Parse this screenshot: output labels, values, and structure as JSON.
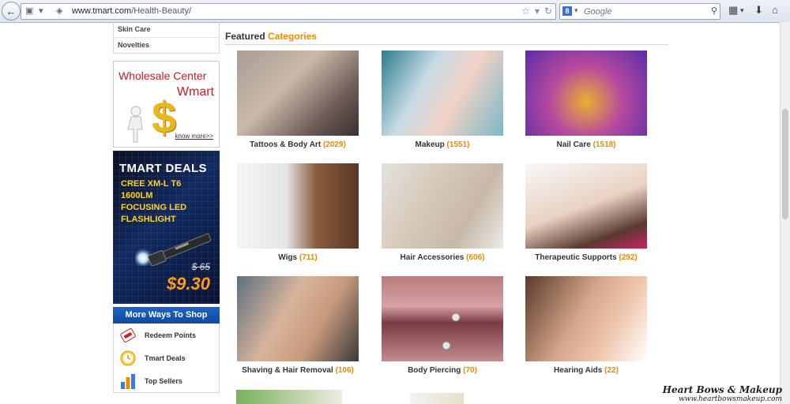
{
  "browser": {
    "url_host": "www.tmart.com",
    "url_path": "/Health-Beauty/",
    "search_placeholder": "Google",
    "search_engine_letter": "8"
  },
  "sidebar": {
    "categories": [
      "Skin Care",
      "Novelties"
    ],
    "wholesale_ad": {
      "title": "Wholesale Center",
      "subtitle": "Wmart",
      "link": "know more>>"
    },
    "deals_ad": {
      "title": "TMART DEALS",
      "lines": [
        "CREE XM-L T6",
        "1600LM",
        "FOCUSING LED",
        "FLASHLIGHT"
      ],
      "old_price": "$ 65",
      "new_price": "$9.30"
    },
    "more_ways": {
      "heading": "More Ways To Shop",
      "items": [
        "Redeem Points",
        "Tmart Deals",
        "Top Sellers"
      ]
    }
  },
  "main": {
    "featured_prefix": "Featured",
    "featured_accent": "Categories",
    "categories": [
      {
        "name": "Tattoos & Body Art",
        "count": "(2029)"
      },
      {
        "name": "Makeup",
        "count": "(1551)"
      },
      {
        "name": "Nail Care",
        "count": "(1518)"
      },
      {
        "name": "Wigs",
        "count": "(711)"
      },
      {
        "name": "Hair Accessories",
        "count": "(606)"
      },
      {
        "name": "Therapeutic Supports",
        "count": "(292)"
      },
      {
        "name": "Shaving & Hair Removal",
        "count": "(106)"
      },
      {
        "name": "Body Piercing",
        "count": "(70)"
      },
      {
        "name": "Hearing Aids",
        "count": "(22)"
      }
    ]
  },
  "watermark": {
    "line1": "Heart Bows & Makeup",
    "line2": "www.heartbowsmakeup.com"
  },
  "colors": {
    "accent": "#f08a00",
    "nav_blue": "#1f63c2",
    "ad_red": "#c21f1f"
  }
}
